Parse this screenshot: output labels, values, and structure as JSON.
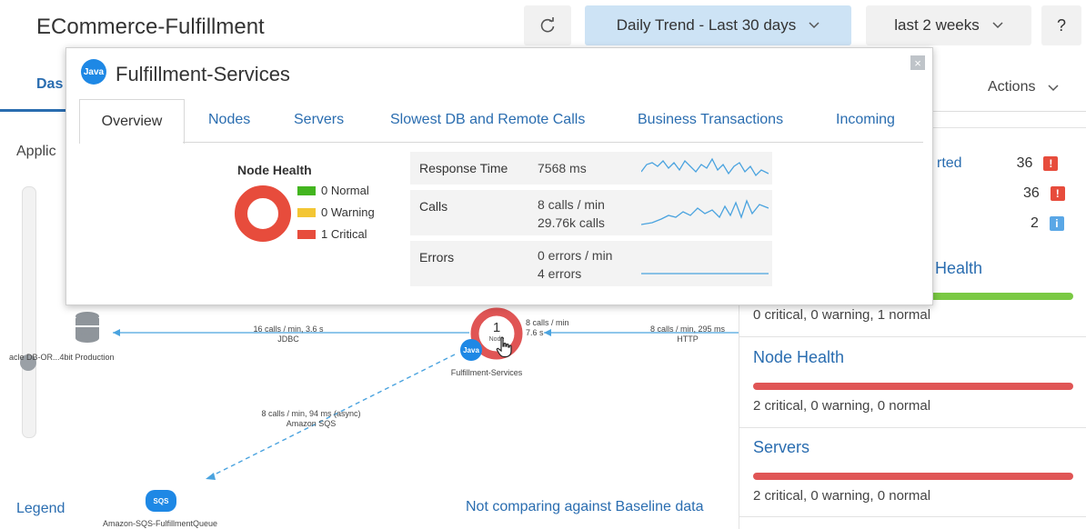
{
  "header": {
    "app_title": "ECommerce-Fulfillment",
    "trend_label": "Daily Trend - Last 30 days",
    "range_label": "last 2 weeks",
    "help_label": "?"
  },
  "dashboard": {
    "tab_label": "Das",
    "actions_label": "Actions",
    "applic_label": "Applic"
  },
  "right_panel": {
    "severity": [
      {
        "label": "rted",
        "count": "36",
        "color": "#e74c3c",
        "icon": "critical-icon"
      },
      {
        "label": "",
        "count": "36",
        "color": "#e74c3c",
        "icon": "critical-icon"
      },
      {
        "label": "",
        "count": "2",
        "color": "#5aa7e6",
        "icon": "info-icon"
      }
    ],
    "partial_health_title": "Health",
    "partial_health_text": "0 critical, 0 warning, 1 normal",
    "node_health_title": "Node Health",
    "node_health_text": "2 critical, 0 warning, 0 normal",
    "servers_title": "Servers",
    "servers_text": "2 critical, 0 warning, 0 normal"
  },
  "flowmap": {
    "db_label": "acle DB-OR...4bit Production",
    "jdbc_line1": "16 calls / min, 3.6 s",
    "jdbc_line2": "JDBC",
    "node_count": "1",
    "node_sub": "Node",
    "self_line1": "8 calls / min",
    "self_line2": "7.6 s",
    "http_line1": "8 calls / min, 295 ms",
    "http_line2": "HTTP",
    "service_label": "Fulfillment-Services",
    "java_badge": "Java",
    "sqs_line1": "8 calls / min, 94 ms (async)",
    "sqs_line2": "Amazon SQS",
    "sqs_badge": "SQS",
    "queue_label": "Amazon-SQS-FulfillmentQueue",
    "legend": "Legend",
    "baseline": "Not comparing against Baseline data"
  },
  "popup": {
    "java_badge": "Java",
    "title": "Fulfillment-Services",
    "close": "×",
    "tabs": [
      "Overview",
      "Nodes",
      "Servers",
      "Slowest DB and Remote Calls",
      "Business Transactions",
      "Incoming"
    ],
    "node_health_title": "Node Health",
    "legend": [
      {
        "label": "0 Normal",
        "color": "#43b51f"
      },
      {
        "label": "0 Warning",
        "color": "#f3c634"
      },
      {
        "label": "1 Critical",
        "color": "#e74c3c"
      }
    ],
    "metrics": {
      "response_label": "Response Time",
      "response_value": "7568 ms",
      "calls_label": "Calls",
      "calls_value1": "8 calls / min",
      "calls_value2": "29.76k calls",
      "errors_label": "Errors",
      "errors_value1": "0 errors / min",
      "errors_value2": "4 errors"
    }
  },
  "colors": {
    "accent": "#2a6db0",
    "critical": "#e74c3c",
    "normal": "#7ac943",
    "sparkline": "#4aa3df"
  }
}
